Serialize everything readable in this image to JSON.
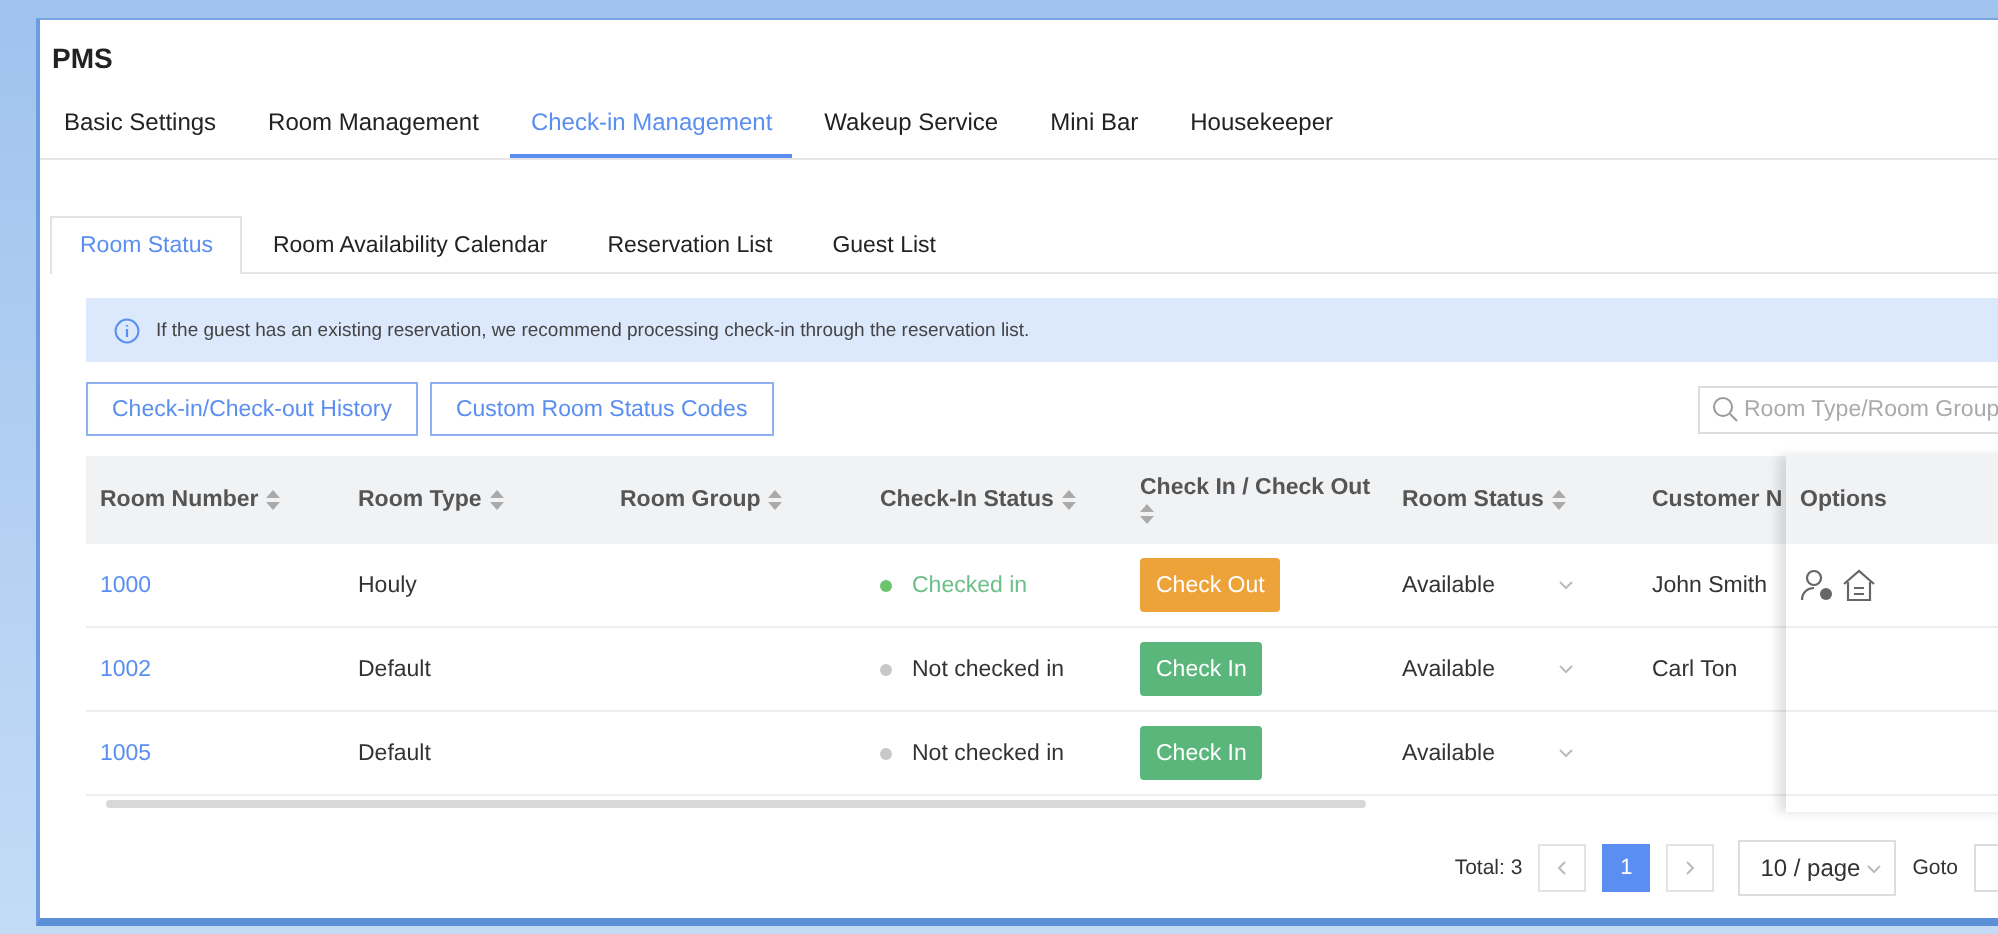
{
  "window": {
    "title": "PMS"
  },
  "tabs": [
    {
      "label": "Basic Settings",
      "selected": false
    },
    {
      "label": "Room Management",
      "selected": false
    },
    {
      "label": "Check-in Management",
      "selected": true
    },
    {
      "label": "Wakeup Service",
      "selected": false
    },
    {
      "label": "Mini Bar",
      "selected": false
    },
    {
      "label": "Housekeeper",
      "selected": false
    }
  ],
  "sub_tabs": [
    {
      "label": "Room Status",
      "selected": true
    },
    {
      "label": "Room Availability Calendar",
      "selected": false
    },
    {
      "label": "Reservation List",
      "selected": false
    },
    {
      "label": "Guest List",
      "selected": false
    }
  ],
  "notice": "If the guest has an existing reservation, we recommend processing check-in through the reservation list.",
  "buttons": [
    "Check-in/Check-out History",
    "Custom Room Status Codes"
  ],
  "search": {
    "placeholder": "Room Type/Room Group"
  },
  "table": {
    "columns": [
      {
        "label": "Room Number",
        "sortable": true
      },
      {
        "label": "Room Type",
        "sortable": true
      },
      {
        "label": "Room Group",
        "sortable": true
      },
      {
        "label": "Check-In Status",
        "sortable": true
      },
      {
        "label": "Check In / Check Out",
        "sortable": true
      },
      {
        "label": "Room Status",
        "sortable": true
      },
      {
        "label": "Customer N"
      },
      {
        "label": "Options"
      }
    ],
    "rows": [
      {
        "room_number": "1000",
        "room_type": "Houly",
        "check_in_status": {
          "label": "Checked in",
          "checked_in": true
        },
        "action": {
          "label": "Check Out",
          "kind": "check_out"
        },
        "room_status": "Available",
        "customer_name": "John Smith",
        "options": [
          {
            "kind": "guest"
          },
          {
            "kind": "house"
          }
        ]
      },
      {
        "room_number": "1002",
        "room_type": "Default",
        "check_in_status": {
          "label": "Not checked in",
          "checked_in": false
        },
        "action": {
          "label": "Check In",
          "kind": "check_in"
        },
        "room_status": "Available",
        "customer_name": "Carl Ton"
      },
      {
        "room_number": "1005",
        "room_type": "Default",
        "check_in_status": {
          "label": "Not checked in",
          "checked_in": false
        },
        "action": {
          "label": "Check In",
          "kind": "check_in"
        },
        "room_status": "Available"
      }
    ]
  },
  "pagination": {
    "total": "Total: 3",
    "pages": [
      {
        "label": "1",
        "selected": true
      }
    ],
    "page_size": "10 / page",
    "goto": "Goto"
  }
}
